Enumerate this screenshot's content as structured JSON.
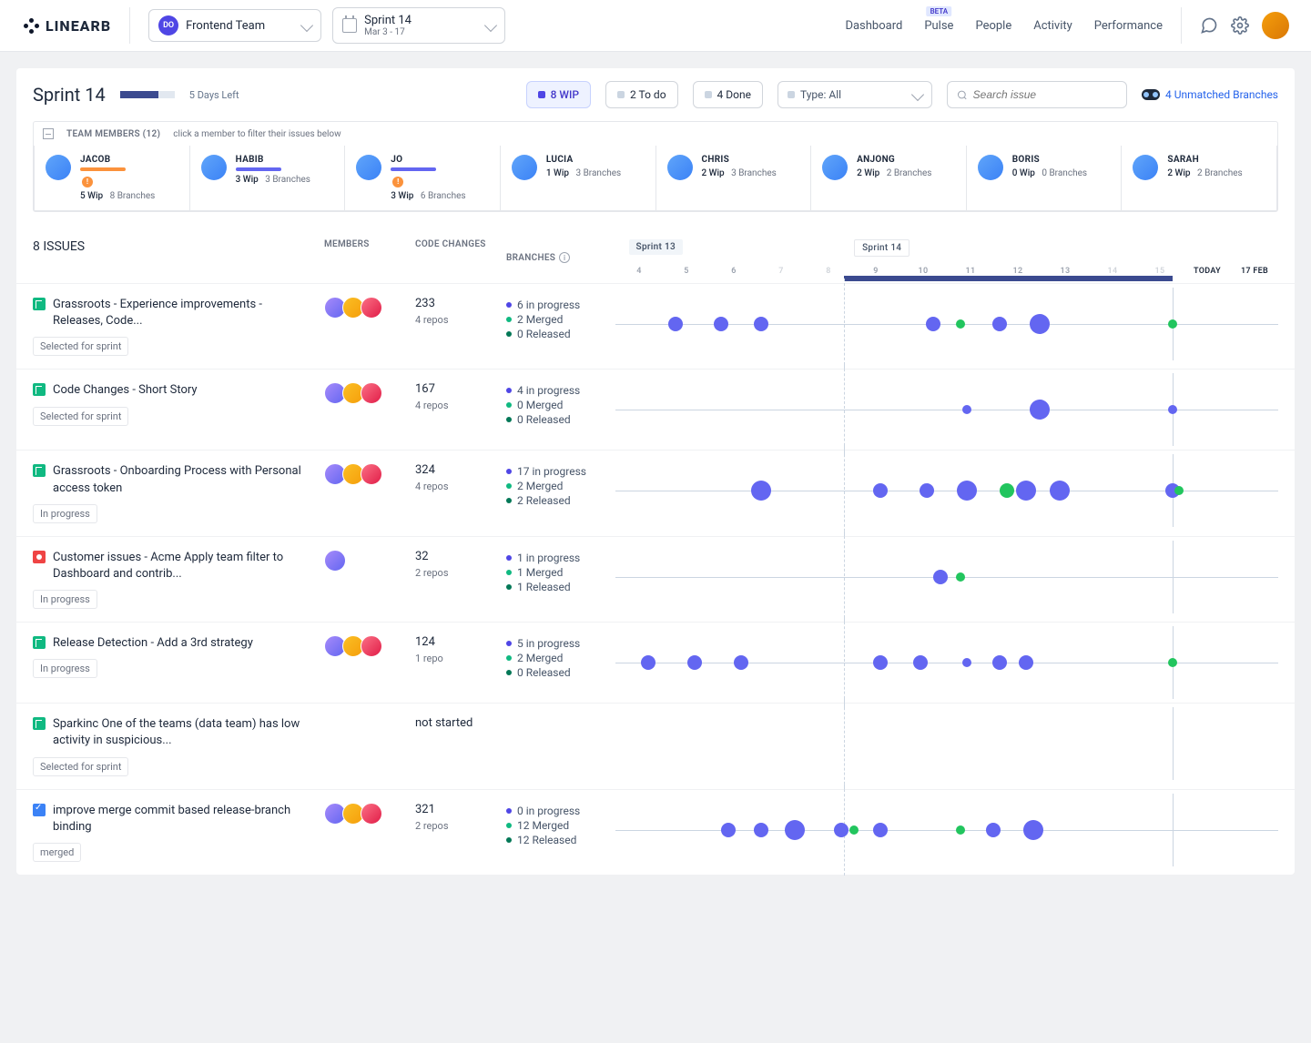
{
  "logo": "LINEARB",
  "team_picker": {
    "avatar": "DO",
    "name": "Frontend Team"
  },
  "sprint_picker": {
    "name": "Sprint 14",
    "dates": "Mar 3 - 17"
  },
  "nav": {
    "dashboard": "Dashboard",
    "pulse": "Pulse",
    "pulse_badge": "BETA",
    "people": "People",
    "activity": "Activity",
    "performance": "Performance"
  },
  "header": {
    "title": "Sprint 14",
    "days_left": "5 Days Left",
    "wip": "8 WIP",
    "todo": "2 To do",
    "done": "4 Done",
    "type": "Type: All",
    "search_placeholder": "Search issue",
    "unmatched": "4 Unmatched Branches"
  },
  "team": {
    "label": "TEAM MEMBERS (12)",
    "hint": "click a member to filter their issues below",
    "members": [
      {
        "name": "JACOB",
        "wip": "5 Wip",
        "branches": "8 Branches",
        "bar": "orange",
        "alert": true
      },
      {
        "name": "HABIB",
        "wip": "3 Wip",
        "branches": "3 Branches",
        "bar": "blue"
      },
      {
        "name": "JO",
        "wip": "3 Wip",
        "branches": "6 Branches",
        "bar": "blue",
        "alert": true
      },
      {
        "name": "LUCIA",
        "wip": "1 Wip",
        "branches": "3 Branches"
      },
      {
        "name": "CHRIS",
        "wip": "2 Wip",
        "branches": "3 Branches"
      },
      {
        "name": "ANJONG",
        "wip": "2 Wip",
        "branches": "2 Branches"
      },
      {
        "name": "BORIS",
        "wip": "0 Wip",
        "branches": "0 Branches"
      },
      {
        "name": "SARAH",
        "wip": "2 Wip",
        "branches": "2 Branches"
      }
    ]
  },
  "issues_header": {
    "title": "8 ISSUES",
    "members": "MEMBERS",
    "changes": "CODE CHANGES",
    "branches": "BRANCHES"
  },
  "timeline": {
    "sprint_prev": "Sprint 13",
    "sprint_curr": "Sprint 14",
    "dates": [
      "4",
      "5",
      "6",
      "7",
      "8",
      "9",
      "10",
      "11",
      "12",
      "13",
      "14",
      "15",
      "TODAY",
      "17 FEB"
    ]
  },
  "issues": [
    {
      "type": "story",
      "title": "Grassroots - Experience improvements - Releases, Code...",
      "tag": "Selected for sprint",
      "avatars": 3,
      "changes": "233",
      "repos": "4 repos",
      "b1": "6 in progress",
      "b2": "2 Merged",
      "b3": "0 Released",
      "bubbles": [
        [
          9,
          "m",
          "b"
        ],
        [
          16,
          "m",
          "b"
        ],
        [
          22,
          "m",
          "b"
        ],
        [
          48,
          "m",
          "b"
        ],
        [
          52,
          "s",
          "g"
        ],
        [
          58,
          "m",
          "b"
        ],
        [
          64,
          "l",
          "b"
        ],
        [
          84,
          "s",
          "g"
        ]
      ]
    },
    {
      "type": "story",
      "title": "Code Changes - Short Story",
      "tag": "Selected for sprint",
      "avatars": 3,
      "changes": "167",
      "repos": "4 repos",
      "b1": "4 in progress",
      "b2": "0 Merged",
      "b3": "0 Released",
      "bubbles": [
        [
          53,
          "s",
          "b"
        ],
        [
          64,
          "l",
          "b"
        ],
        [
          84,
          "s",
          "b"
        ]
      ]
    },
    {
      "type": "story",
      "title": "Grassroots - Onboarding Process with Personal access token",
      "tag": "In progress",
      "avatars": 3,
      "changes": "324",
      "repos": "4 repos",
      "b1": "17 in progress",
      "b2": "2 Merged",
      "b3": "2 Released",
      "bubbles": [
        [
          22,
          "l",
          "b"
        ],
        [
          40,
          "m",
          "b"
        ],
        [
          47,
          "m",
          "b"
        ],
        [
          53,
          "l",
          "b"
        ],
        [
          59,
          "m",
          "g"
        ],
        [
          62,
          "l",
          "b"
        ],
        [
          67,
          "l",
          "b"
        ],
        [
          84,
          "m",
          "b"
        ],
        [
          85,
          "s",
          "g"
        ]
      ]
    },
    {
      "type": "bug",
      "title": "Customer issues - Acme Apply team filter to Dashboard and contrib...",
      "tag": "In progress",
      "avatars": 1,
      "changes": "32",
      "repos": "2 repos",
      "b1": "1 in progress",
      "b2": "1 Merged",
      "b3": "1 Released",
      "bubbles": [
        [
          49,
          "m",
          "b"
        ],
        [
          52,
          "s",
          "g"
        ]
      ]
    },
    {
      "type": "story",
      "title": "Release Detection - Add a 3rd strategy",
      "tag": "In progress",
      "avatars": 3,
      "changes": "124",
      "repos": "1 repo",
      "b1": "5 in progress",
      "b2": "2 Merged",
      "b3": "0 Released",
      "bubbles": [
        [
          5,
          "m",
          "b"
        ],
        [
          12,
          "m",
          "b"
        ],
        [
          19,
          "m",
          "b"
        ],
        [
          40,
          "m",
          "b"
        ],
        [
          46,
          "m",
          "b"
        ],
        [
          53,
          "s",
          "b"
        ],
        [
          58,
          "m",
          "b"
        ],
        [
          62,
          "m",
          "b"
        ],
        [
          84,
          "s",
          "g"
        ]
      ]
    },
    {
      "type": "story",
      "title": "Sparkinc One of the teams (data team) has low activity in suspicious...",
      "tag": "Selected for sprint",
      "avatars": 0,
      "changes": "not started",
      "repos": "",
      "b1": "",
      "b2": "",
      "b3": "",
      "bubbles": [],
      "noline": true
    },
    {
      "type": "task",
      "title": "improve merge commit based release-branch binding",
      "tag": "merged",
      "avatars": 3,
      "changes": "321",
      "repos": "2 repos",
      "b1": "0 in progress",
      "b2": "12 Merged",
      "b3": "12 Released",
      "bubbles": [
        [
          17,
          "m",
          "b"
        ],
        [
          22,
          "m",
          "b"
        ],
        [
          27,
          "l",
          "b"
        ],
        [
          34,
          "m",
          "b"
        ],
        [
          36,
          "s",
          "g"
        ],
        [
          40,
          "m",
          "b"
        ],
        [
          52,
          "s",
          "g"
        ],
        [
          57,
          "m",
          "b"
        ],
        [
          63,
          "l",
          "b"
        ]
      ]
    }
  ]
}
